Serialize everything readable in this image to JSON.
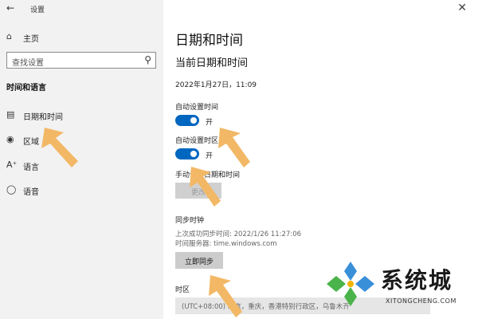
{
  "window": {
    "app_title": "设置",
    "back_icon": "back-arrow-icon",
    "close_icon": "close-icon"
  },
  "sidebar": {
    "home_label": "主页",
    "search_placeholder": "查找设置",
    "section_title": "时间和语言",
    "items": [
      {
        "label": "日期和时间",
        "icon": "clock-calendar-icon"
      },
      {
        "label": "区域",
        "icon": "globe-icon"
      },
      {
        "label": "语言",
        "icon": "language-icon"
      },
      {
        "label": "语音",
        "icon": "microphone-icon"
      }
    ]
  },
  "main": {
    "page_title": "日期和时间",
    "subhead": "当前日期和时间",
    "current_datetime": "2022年1月27日，11:09",
    "auto_time": {
      "label": "自动设置时间",
      "state": "开",
      "on": true
    },
    "auto_timezone": {
      "label": "自动设置时区",
      "state": "开",
      "on": true
    },
    "manual": {
      "label": "手动设置日期和时间",
      "button": "更改"
    },
    "sync": {
      "title": "同步时钟",
      "last_sync": "上次成功同步时间: 2022/1/26 11:27:06",
      "server": "时间服务器: time.windows.com",
      "button": "立即同步"
    },
    "timezone": {
      "label": "时区",
      "value": "(UTC+08:00) 北京，重庆，香港特别行政区，乌鲁木齐"
    }
  },
  "watermark": {
    "text": "系统城",
    "url": "XITONGCHENG.COM"
  },
  "colors": {
    "accent": "#0067c0",
    "arrow": "#f2b866",
    "sidebar_bg": "#f2f2f2"
  }
}
